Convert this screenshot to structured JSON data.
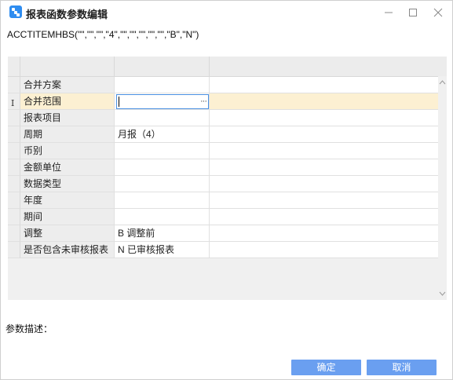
{
  "window": {
    "title": "报表函数参数编辑",
    "icon": "app-icon"
  },
  "formula": "ACCTITEMHBS(\"\",\"\",\"\",\"4\",\"\",\"\",\"\",\"\",\"\",\"B\",\"N\")",
  "params": [
    {
      "name": "合并方案",
      "value": ""
    },
    {
      "name": "合并范围",
      "value": ""
    },
    {
      "name": "报表项目",
      "value": ""
    },
    {
      "name": "周期",
      "value": "月报（4）"
    },
    {
      "name": "币别",
      "value": ""
    },
    {
      "name": "金额单位",
      "value": ""
    },
    {
      "name": "数据类型",
      "value": ""
    },
    {
      "name": "年度",
      "value": ""
    },
    {
      "name": "期间",
      "value": ""
    },
    {
      "name": "调整",
      "value": "B  调整前"
    },
    {
      "name": "是否包含未审核报表",
      "value": "N  已审核报表"
    }
  ],
  "active_row_marker": "I",
  "editor_button": "···",
  "description_label": "参数描述：",
  "buttons": {
    "ok": "确定",
    "cancel": "取消"
  },
  "colors": {
    "accent": "#2f8df0",
    "button": "#6a9ff0",
    "active_row": "#fcf0d2",
    "editor_border": "#4a90e2"
  }
}
